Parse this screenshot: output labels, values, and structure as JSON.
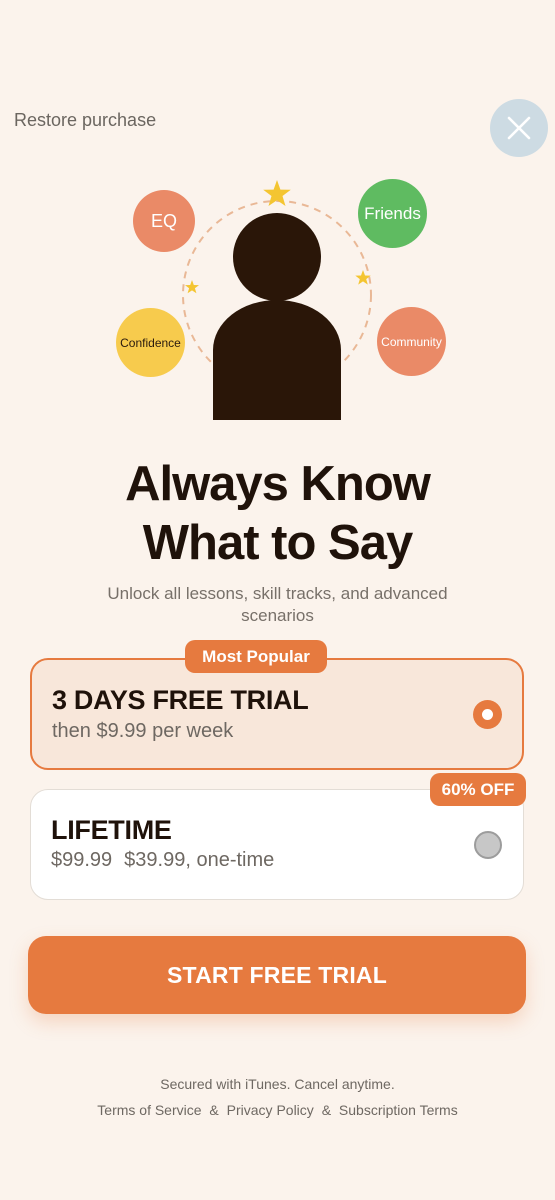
{
  "header": {
    "restore_label": "Restore purchase",
    "close_icon": "close-icon"
  },
  "hero": {
    "bubbles": {
      "eq": "EQ",
      "friends": "Friends",
      "confidence": "Confidence",
      "community": "Community"
    },
    "icons": [
      "person-icon",
      "star-icon"
    ]
  },
  "title": {
    "line1": "Always Know",
    "line2": "What to Say"
  },
  "subtitle": "Unlock all lessons, skill tracks, and advanced scenarios",
  "plans": [
    {
      "badge": "Most Popular",
      "title": "3 DAYS FREE TRIAL",
      "subtitle": "then $9.99 per week",
      "selected": true
    },
    {
      "badge": "60% OFF",
      "title": "LIFETIME",
      "old_price": "$99.99",
      "price_text": "$39.99, one-time",
      "selected": false
    }
  ],
  "cta_label": "START FREE TRIAL",
  "footer": {
    "line1": "Secured with iTunes. Cancel anytime.",
    "terms": "Terms of Service",
    "amp1": "&",
    "privacy": "Privacy Policy",
    "amp2": "&",
    "subscription": "Subscription Terms"
  },
  "colors": {
    "background": "#FBF3EC",
    "accent": "#E67A3F",
    "text_dark": "#1F120A",
    "close_bg": "#CDDBE3",
    "green": "#5FBB61",
    "salmon": "#EA8A67",
    "yellow": "#F7CB4D"
  }
}
